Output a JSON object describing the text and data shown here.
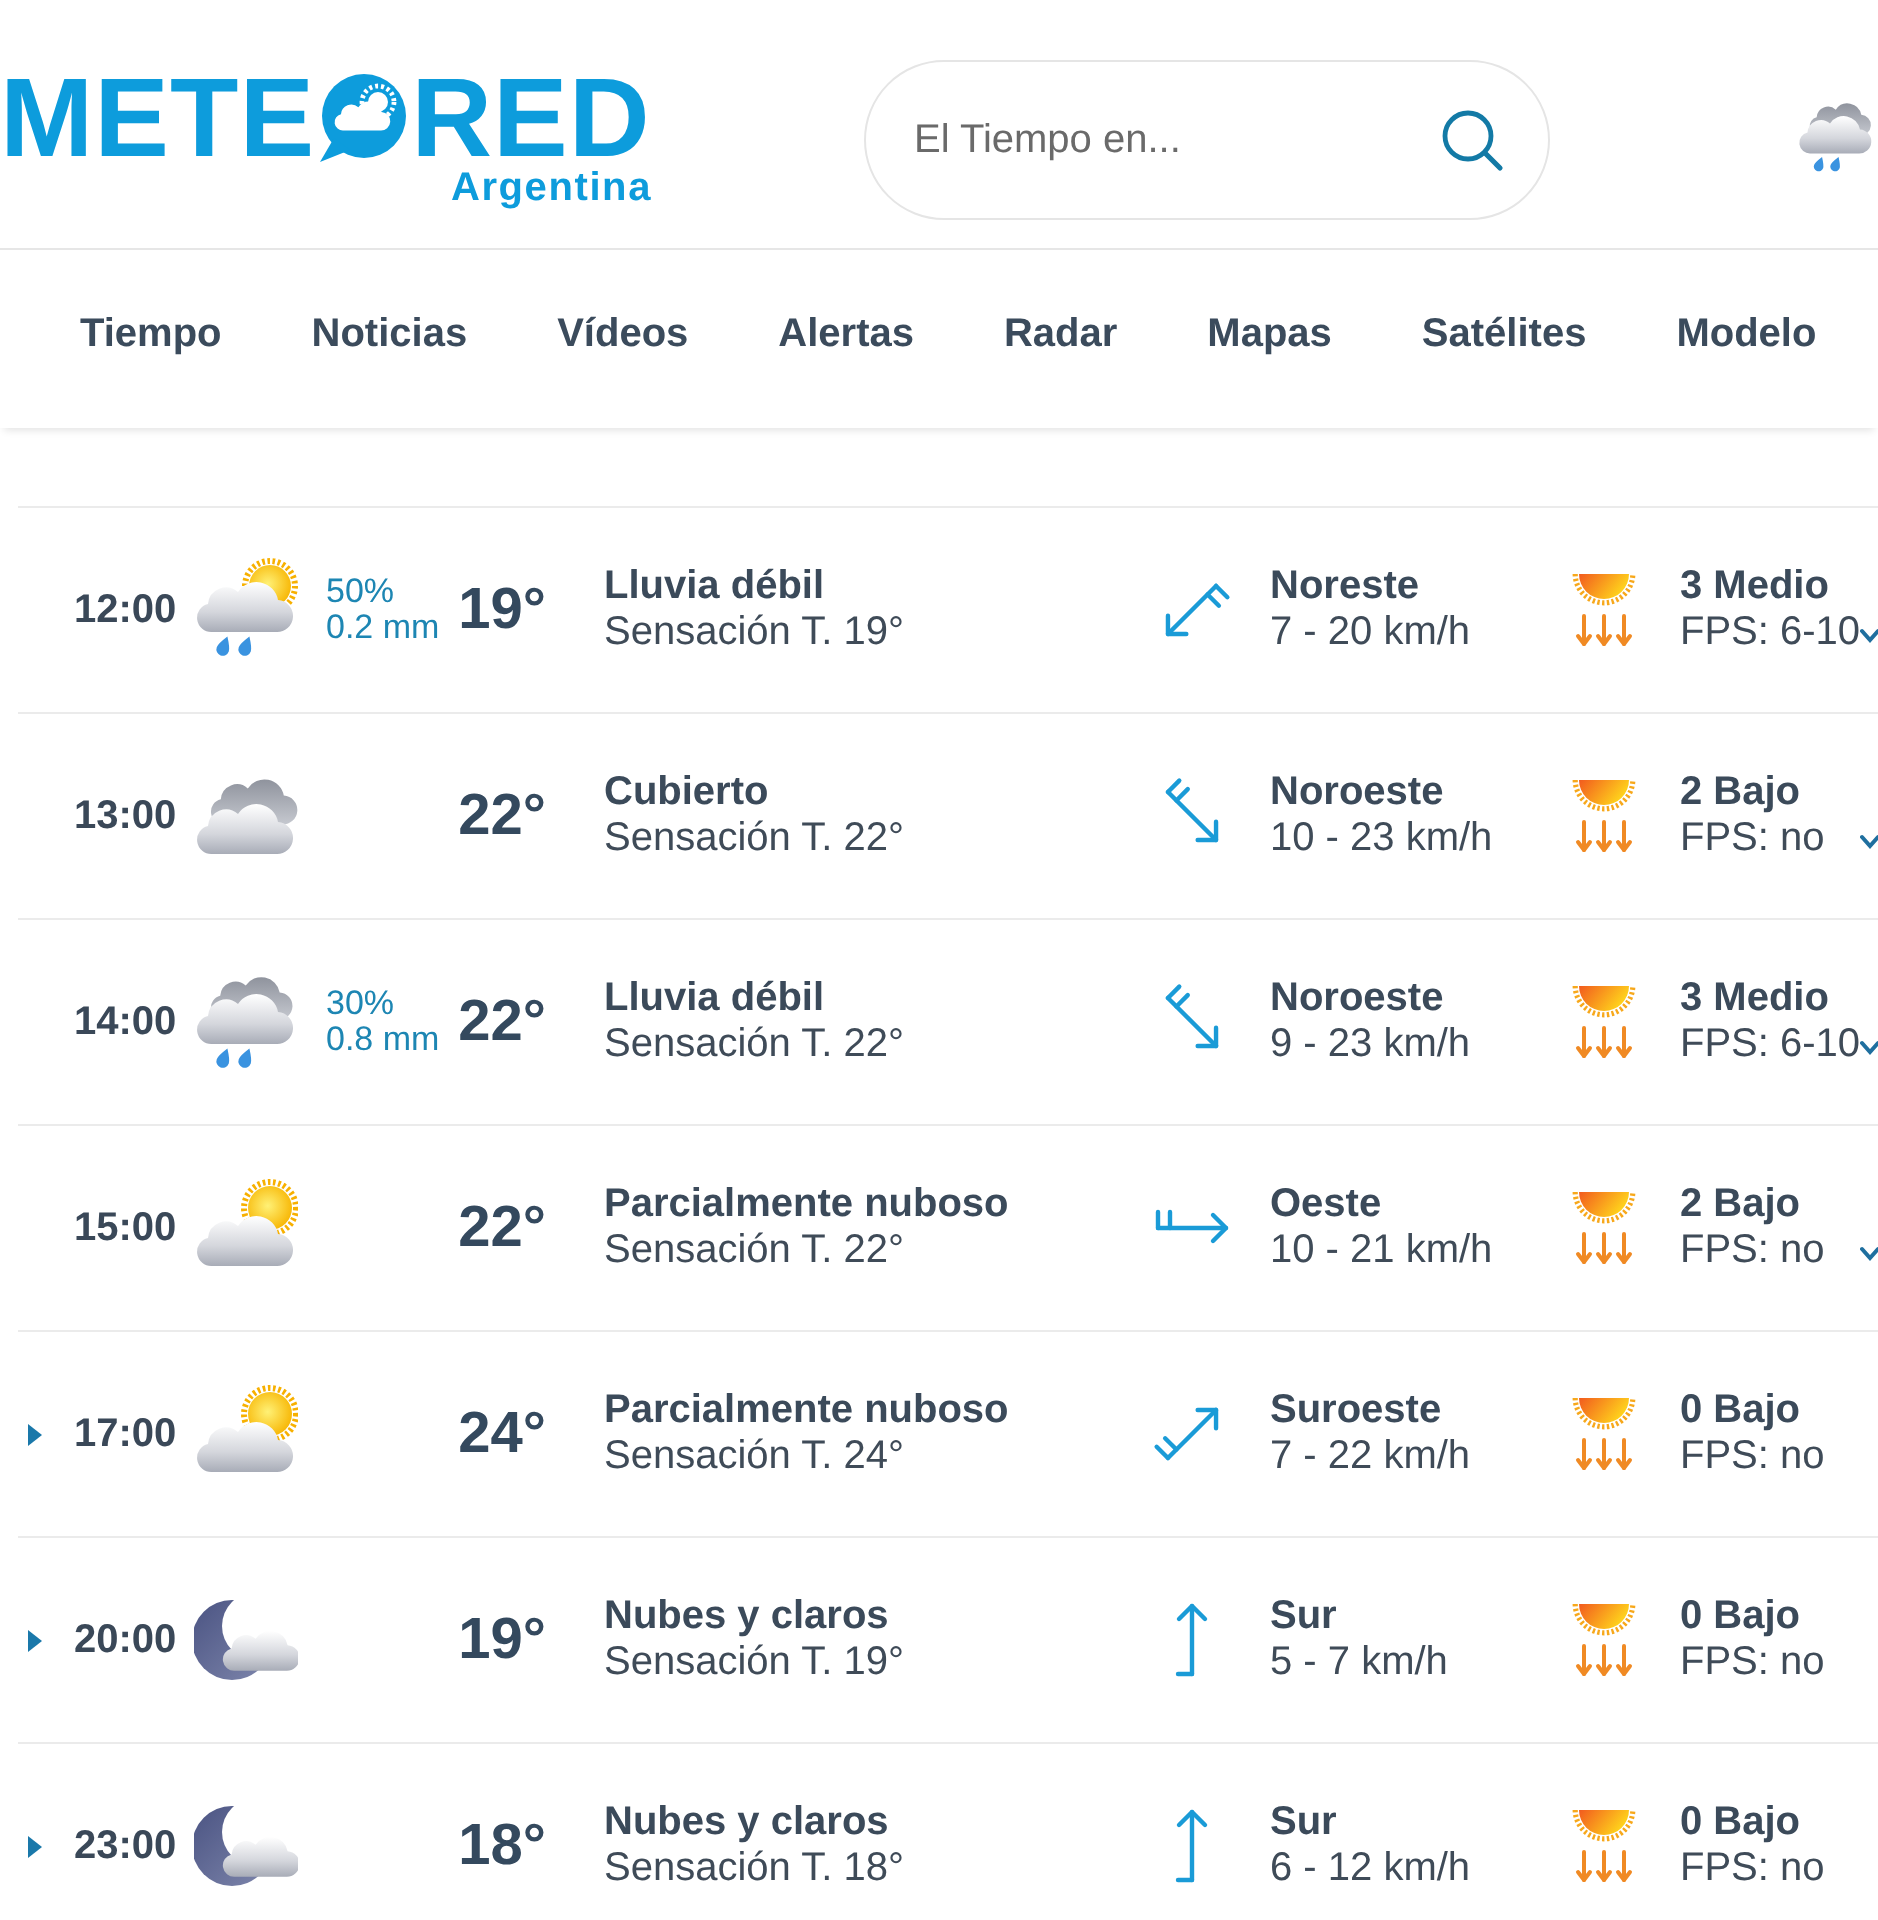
{
  "header": {
    "logo": {
      "part_1": "METE",
      "part_2": "RED",
      "region": "Argentina"
    },
    "search": {
      "placeholder": "El Tiempo en..."
    }
  },
  "nav": [
    {
      "label": "Tiempo"
    },
    {
      "label": "Noticias"
    },
    {
      "label": "Vídeos"
    },
    {
      "label": "Alertas"
    },
    {
      "label": "Radar"
    },
    {
      "label": "Mapas"
    },
    {
      "label": "Satélites"
    },
    {
      "label": "Modelo"
    }
  ],
  "rows": [
    {
      "caret": false,
      "time": "12:00",
      "icon": {
        "kind": "sunrain"
      },
      "precip_chance": "50%",
      "precip_amount": "0.2 mm",
      "temp": "19°",
      "summary": "Lluvia débil",
      "feels_like": "Sensación T. 19°",
      "wind_arrow": {
        "kind": "sw",
        "double_barb": true
      },
      "wind_dir": "Noreste",
      "wind_speed": "7 - 20 km/h",
      "uv": "3 Medio",
      "fps": "FPS: 6-10",
      "chevron": true
    },
    {
      "caret": false,
      "time": "13:00",
      "icon": {
        "kind": "cloud"
      },
      "temp": "22°",
      "summary": "Cubierto",
      "feels_like": "Sensación T. 22°",
      "wind_arrow": {
        "kind": "se",
        "double_barb": true
      },
      "wind_dir": "Noroeste",
      "wind_speed": "10 - 23 km/h",
      "uv": "2 Bajo",
      "fps": "FPS: no",
      "chevron": true
    },
    {
      "caret": false,
      "time": "14:00",
      "icon": {
        "kind": "rain"
      },
      "precip_chance": "30%",
      "precip_amount": "0.8 mm",
      "temp": "22°",
      "summary": "Lluvia débil",
      "feels_like": "Sensación T. 22°",
      "wind_arrow": {
        "kind": "se",
        "double_barb": true
      },
      "wind_dir": "Noroeste",
      "wind_speed": "9 - 23 km/h",
      "uv": "3 Medio",
      "fps": "FPS: 6-10",
      "chevron": true
    },
    {
      "caret": false,
      "time": "15:00",
      "icon": {
        "kind": "suncloud"
      },
      "temp": "22°",
      "summary": "Parcialmente nuboso",
      "feels_like": "Sensación T. 22°",
      "wind_arrow": {
        "kind": "e",
        "double_barb": true
      },
      "wind_dir": "Oeste",
      "wind_speed": "10 - 21 km/h",
      "uv": "2 Bajo",
      "fps": "FPS: no",
      "chevron": true
    },
    {
      "caret": true,
      "time": "17:00",
      "icon": {
        "kind": "suncloud"
      },
      "temp": "24°",
      "summary": "Parcialmente nuboso",
      "feels_like": "Sensación T. 24°",
      "wind_arrow": {
        "kind": "ne",
        "double_barb": true
      },
      "wind_dir": "Suroeste",
      "wind_speed": "7 - 22 km/h",
      "uv": "0 Bajo",
      "fps": "FPS: no",
      "chevron": false
    },
    {
      "caret": true,
      "time": "20:00",
      "icon": {
        "kind": "mooncloud"
      },
      "temp": "19°",
      "summary": "Nubes y claros",
      "feels_like": "Sensación T. 19°",
      "wind_arrow": {
        "kind": "n",
        "double_barb": false
      },
      "wind_dir": "Sur",
      "wind_speed": "5 - 7 km/h",
      "uv": "0 Bajo",
      "fps": "FPS: no",
      "chevron": false
    },
    {
      "caret": true,
      "time": "23:00",
      "icon": {
        "kind": "mooncloud"
      },
      "temp": "18°",
      "summary": "Nubes y claros",
      "feels_like": "Sensación T. 18°",
      "wind_arrow": {
        "kind": "n",
        "double_barb": false
      },
      "wind_dir": "Sur",
      "wind_speed": "6 - 12 km/h",
      "uv": "0 Bajo",
      "fps": "FPS: no",
      "chevron": false
    }
  ]
}
